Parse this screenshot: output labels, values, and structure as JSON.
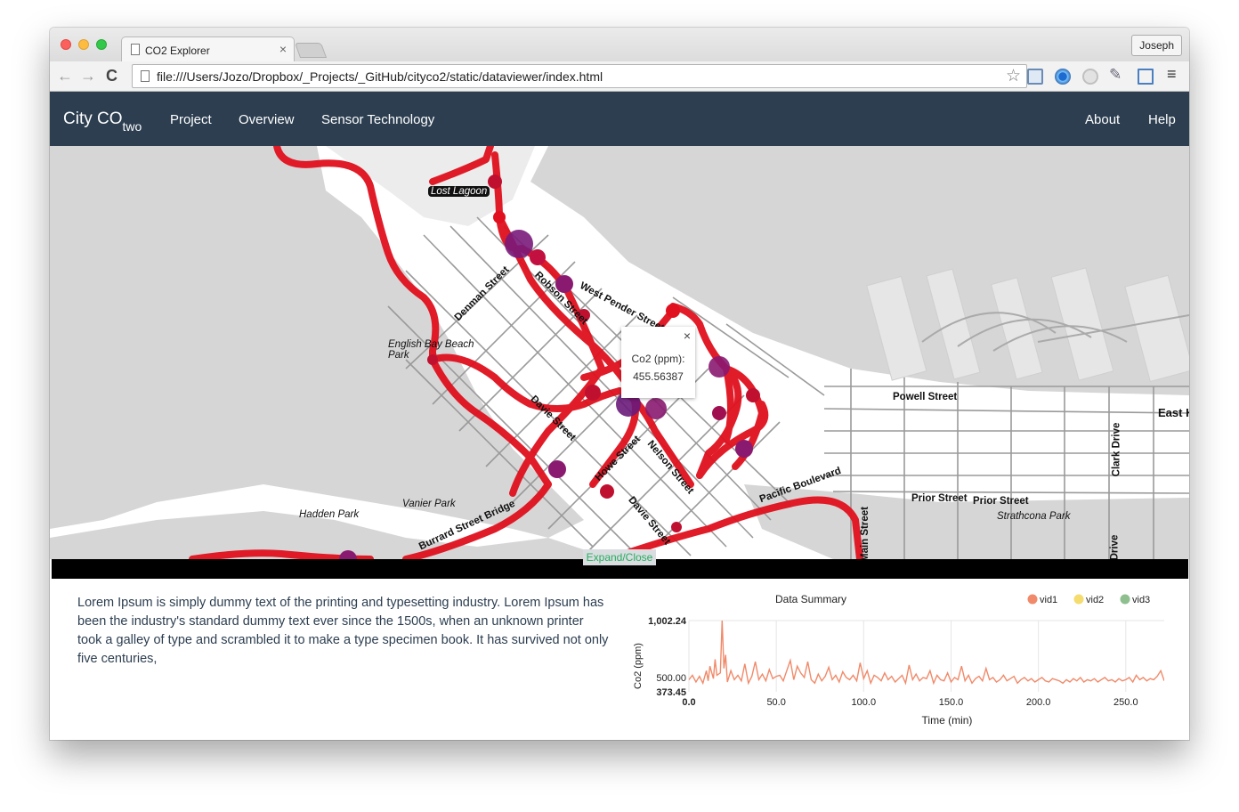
{
  "browser": {
    "tab_title": "CO2 Explorer",
    "tab_close": "×",
    "profile": "Joseph",
    "url": "file:///Users/Jozo/Dropbox/_Projects/_GitHub/cityco2/static/dataviewer/index.html",
    "nav_back": "←",
    "nav_forward": "→",
    "reload": "C",
    "bookmark": "☆",
    "menu": "≡"
  },
  "navbar": {
    "brand_main": "City CO",
    "brand_sub": "two",
    "links": [
      "Project",
      "Overview",
      "Sensor Technology"
    ],
    "right_links": [
      "About",
      "Help"
    ]
  },
  "map": {
    "labels": [
      "Lost Lagoon",
      "Denman Street",
      "Robson Street",
      "West Pender Street",
      "English Bay Beach Park",
      "Davie Street",
      "Howe Street",
      "Nelson Street",
      "Powell Street",
      "East H",
      "Clark Drive",
      "Pacific Boulevard",
      "Prior Street",
      "Prior Street",
      "Strathcona Park",
      "Vanier Park",
      "Hadden Park",
      "Burrard Street Bridge",
      "Davie Street",
      "Main Street",
      "Drive"
    ],
    "popup": {
      "close": "×",
      "label": "Co2 (ppm):",
      "value": "455.56387"
    },
    "expand_label": "Expand/Close"
  },
  "summary": {
    "text": "Lorem Ipsum is simply dummy text of the printing and typesetting industry. Lorem Ipsum has been the industry's standard dummy text ever since the 1500s, when an unknown printer took a galley of type and scrambled it to make a type specimen book. It has survived not only five centuries,"
  },
  "chart_data": {
    "type": "line",
    "title": "Data Summary",
    "xlabel": "Time (min)",
    "ylabel": "Co2 (ppm)",
    "xlim": [
      0,
      272
    ],
    "ylim": [
      373.45,
      1002.24
    ],
    "x_ticks": [
      "0.0",
      "50.0",
      "100.0",
      "150.0",
      "200.0",
      "250.0"
    ],
    "y_ticks": [
      "1,002.24",
      "500.00",
      "373.45"
    ],
    "legend": [
      {
        "name": "vid1",
        "color": "#f08a6a"
      },
      {
        "name": "vid2",
        "color": "#f5dc6e"
      },
      {
        "name": "vid3",
        "color": "#8fbf8f"
      },
      {
        "name": "",
        "color": "#3a7bbf"
      }
    ],
    "series": [
      {
        "name": "vid1",
        "color": "#f08a6a",
        "x": [
          0,
          2,
          4,
          6,
          8,
          10,
          11,
          12,
          14,
          15,
          16,
          18,
          19,
          20,
          21,
          22,
          24,
          26,
          28,
          30,
          32,
          34,
          36,
          38,
          40,
          42,
          44,
          46,
          48,
          50,
          52,
          54,
          56,
          58,
          60,
          62,
          64,
          66,
          68,
          70,
          72,
          74,
          76,
          78,
          80,
          82,
          84,
          86,
          88,
          90,
          92,
          94,
          96,
          98,
          100,
          102,
          104,
          106,
          108,
          110,
          112,
          114,
          116,
          118,
          120,
          122,
          124,
          126,
          128,
          130,
          132,
          134,
          136,
          138,
          140,
          142,
          144,
          146,
          148,
          150,
          152,
          154,
          156,
          158,
          160,
          162,
          164,
          166,
          168,
          170,
          172,
          174,
          176,
          178,
          180,
          182,
          184,
          186,
          188,
          190,
          192,
          194,
          196,
          198,
          200,
          202,
          204,
          206,
          208,
          210,
          212,
          214,
          216,
          218,
          220,
          222,
          224,
          226,
          228,
          230,
          232,
          234,
          236,
          238,
          240,
          242,
          244,
          246,
          248,
          250,
          252,
          254,
          256,
          258,
          260,
          262,
          264,
          266,
          268,
          270,
          272
        ],
        "y": [
          480,
          520,
          460,
          510,
          450,
          560,
          470,
          600,
          490,
          660,
          520,
          540,
          1002,
          580,
          700,
          460,
          560,
          480,
          520,
          470,
          620,
          450,
          510,
          640,
          480,
          530,
          470,
          570,
          490,
          510,
          520,
          470,
          560,
          650,
          480,
          600,
          540,
          500,
          640,
          480,
          450,
          530,
          470,
          510,
          590,
          480,
          520,
          460,
          550,
          500,
          480,
          520,
          470,
          630,
          490,
          560,
          450,
          520,
          500,
          470,
          540,
          480,
          510,
          460,
          490,
          520,
          450,
          610,
          480,
          530,
          470,
          500,
          490,
          560,
          450,
          520,
          480,
          470,
          540,
          460,
          500,
          480,
          600,
          470,
          520,
          450,
          490,
          510,
          470,
          580,
          480,
          500,
          460,
          480,
          520,
          470,
          490,
          510,
          450,
          480,
          500,
          470,
          490,
          460,
          480,
          500,
          470,
          460,
          490,
          480,
          470,
          450,
          480,
          460,
          490,
          470,
          500,
          460,
          480,
          470,
          490,
          460,
          480,
          500,
          470,
          480,
          460,
          490,
          470,
          480,
          500,
          460,
          520,
          480,
          500,
          470,
          490,
          480,
          510,
          560,
          470
        ]
      }
    ]
  }
}
